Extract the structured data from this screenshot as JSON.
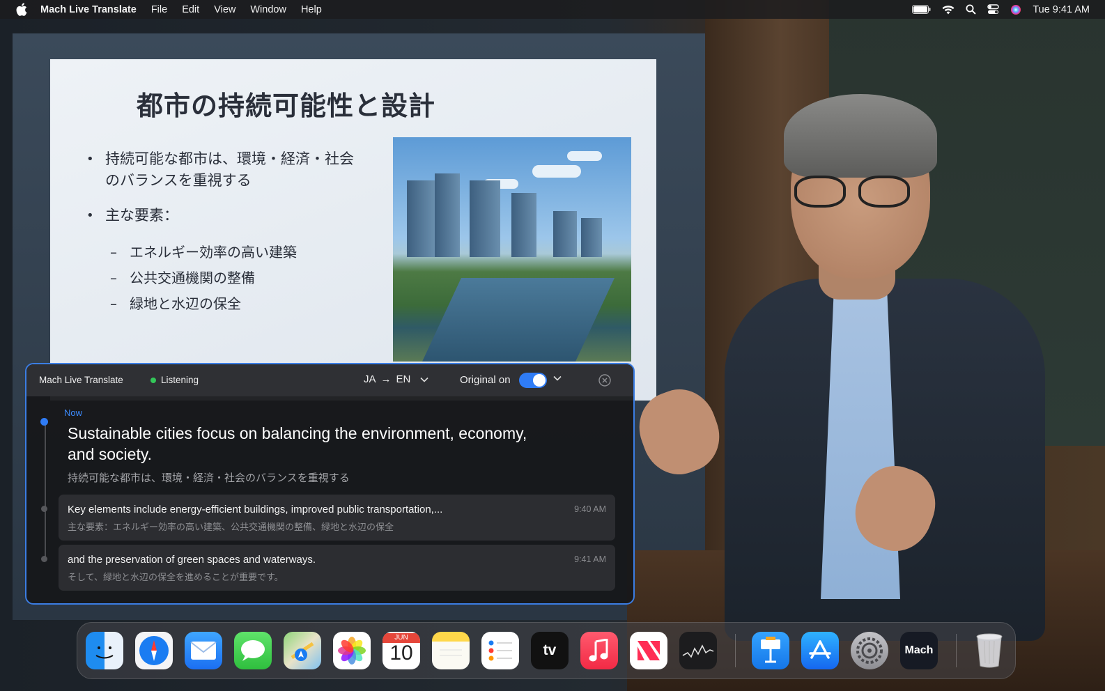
{
  "menubar": {
    "app_name": "Mach Live Translate",
    "menus": [
      "File",
      "Edit",
      "View",
      "Window",
      "Help"
    ],
    "clock": "Tue 9:41 AM"
  },
  "slide": {
    "title": "都市の持続可能性と設計",
    "bullet1_line1": "持続可能な都市は、環境・経済・社会",
    "bullet1_line2": "のバランスを重視する",
    "bullet2": "主な要素：",
    "subs": [
      "エネルギー効率の高い建築",
      "公共交通機関の整備",
      "緑地と水辺の保全"
    ]
  },
  "panel": {
    "app_title": "Mach Live Translate",
    "status": "Listening",
    "source_lang": "JA",
    "arrow": "→",
    "target_lang": "EN",
    "original_label": "Original on",
    "original_on": true,
    "current": {
      "label": "Now",
      "text_en": "Sustainable cities focus on balancing the environment, economy, and society.",
      "text_ja": "持続可能な都市は、環境・経済・社会のバランスを重視する"
    },
    "history": [
      {
        "text_en": "Key elements include energy-efficient buildings, improved public transportation,...",
        "text_ja": "主な要素：エネルギー効率の高い建築、公共交通機関の整備、緑地と水辺の保全",
        "time": "9:40 AM"
      },
      {
        "text_en": "and the preservation of green spaces and waterways.",
        "text_ja": "そして、緑地と水辺の保全を進めることが重要です。",
        "time": "9:41 AM"
      }
    ]
  },
  "dock": {
    "apps": [
      "finder-icon",
      "safari-icon",
      "mail-icon",
      "messages-icon",
      "maps-icon",
      "photos-icon",
      "calendar-icon",
      "notes-icon",
      "reminders-icon",
      "tv-icon",
      "music-icon",
      "news-icon",
      "stocks-icon",
      "keynote-icon",
      "app-store-icon",
      "system-settings-icon",
      "mach-icon",
      "trash-icon"
    ],
    "calendar_month": "JUN",
    "calendar_day": "10",
    "tv_label": "tv",
    "mach_label": "Mach"
  },
  "colors": {
    "accent": "#2f7cf6",
    "listening": "#33c759",
    "panel_border": "#3b7de3"
  }
}
